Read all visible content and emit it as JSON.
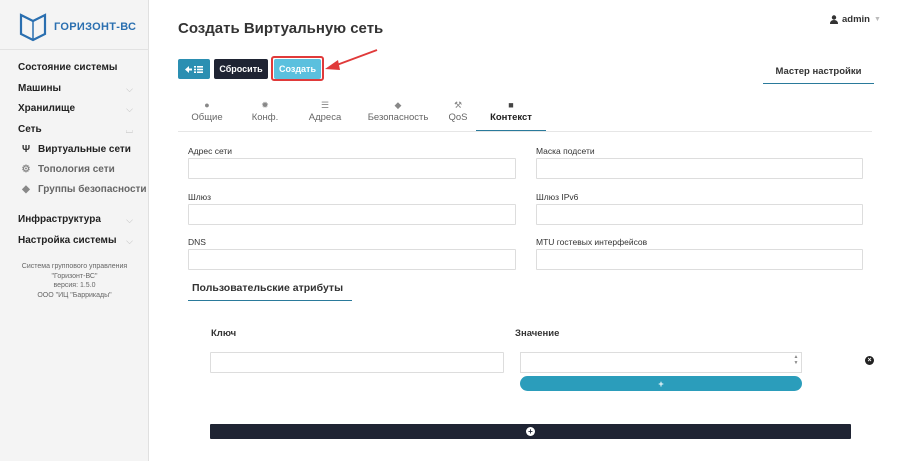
{
  "app": {
    "logo_text": "ГОРИЗОНТ-ВС",
    "accent": "#2a6fb0"
  },
  "sidebar": {
    "items": [
      {
        "label": "Состояние системы"
      },
      {
        "label": "Машины"
      },
      {
        "label": "Хранилище"
      },
      {
        "label": "Сеть"
      },
      {
        "label": "Виртуальные сети",
        "icon": "network-icon",
        "active": true
      },
      {
        "label": "Топология сети",
        "icon": "topology-icon"
      },
      {
        "label": "Группы безопасности",
        "icon": "shield-icon"
      },
      {
        "label": "Инфраструктура"
      },
      {
        "label": "Настройка системы"
      }
    ],
    "info": {
      "line1": "Система группового управления",
      "line2": "\"Горизонт-ВС\"",
      "line3": "версия: 1.5.0",
      "line4": "ООО \"ИЦ \"Баррикады\""
    }
  },
  "header": {
    "title": "Создать Виртуальную сеть",
    "user": "admin"
  },
  "toolbar": {
    "reset_label": "Сбросить",
    "create_label": "Создать",
    "wizard_label": "Мастер настройки"
  },
  "tabs": [
    {
      "label": "Общие",
      "icon": "globe-icon"
    },
    {
      "label": "Конф.",
      "icon": "gear-icon"
    },
    {
      "label": "Адреса",
      "icon": "list-icon"
    },
    {
      "label": "Безопасность",
      "icon": "shield-icon"
    },
    {
      "label": "QoS",
      "icon": "wrench-icon"
    },
    {
      "label": "Контекст",
      "icon": "folder-icon",
      "active": true
    }
  ],
  "form": {
    "network_address": {
      "label": "Адрес сети",
      "value": ""
    },
    "netmask": {
      "label": "Маска подсети",
      "value": ""
    },
    "gateway": {
      "label": "Шлюз",
      "value": ""
    },
    "gateway_ipv6": {
      "label": "Шлюз IPv6",
      "value": ""
    },
    "dns": {
      "label": "DNS",
      "value": ""
    },
    "mtu": {
      "label": "MTU гостевых интерфейсов",
      "value": ""
    }
  },
  "custom_attrs": {
    "title": "Пользовательские атрибуты",
    "key_header": "Ключ",
    "value_header": "Значение"
  },
  "colors": {
    "dark": "#1f2433",
    "primary": "#2b8fb2",
    "info": "#5bc0de",
    "highlight": "#e03a3a"
  }
}
